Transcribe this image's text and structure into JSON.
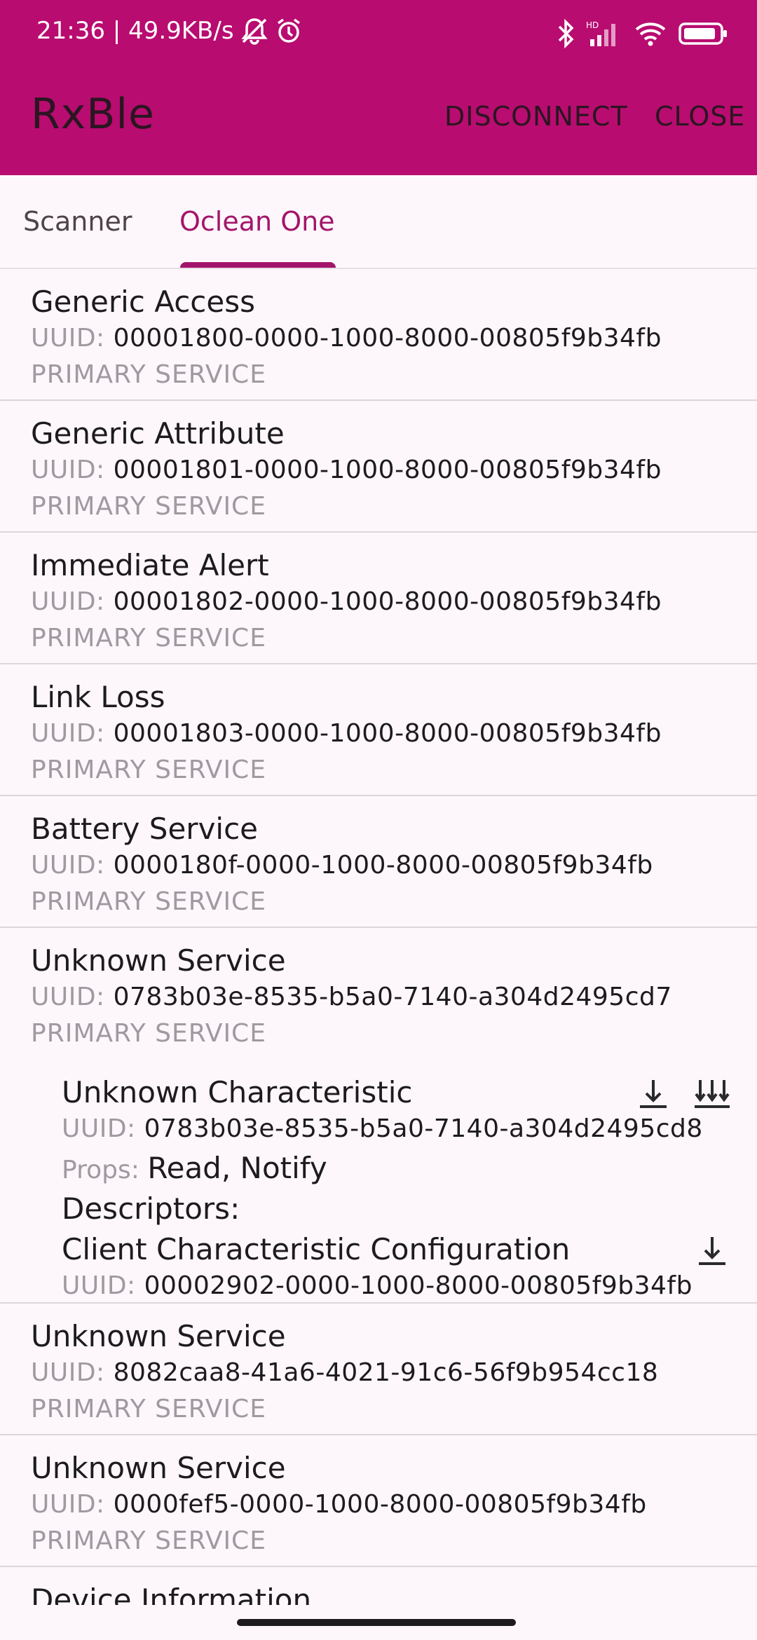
{
  "status": {
    "time_speed": "21:36 | 49.9KB/s",
    "icons": [
      "mute-bell-icon",
      "alarm-icon",
      "bluetooth-icon",
      "signal-hd-icon",
      "wifi-icon",
      "battery-icon"
    ]
  },
  "appbar": {
    "title": "RxBle",
    "disconnect": "DISCONNECT",
    "close": "CLOSE"
  },
  "tabs": [
    {
      "label": "Scanner",
      "active": false
    },
    {
      "label": "Oclean One",
      "active": true
    }
  ],
  "uuid_label": "UUID:",
  "props_label": "Props:",
  "services": [
    {
      "name": "Generic Access",
      "uuid": "00001800-0000-1000-8000-00805f9b34fb",
      "type": "PRIMARY SERVICE"
    },
    {
      "name": "Generic Attribute",
      "uuid": "00001801-0000-1000-8000-00805f9b34fb",
      "type": "PRIMARY SERVICE"
    },
    {
      "name": "Immediate Alert",
      "uuid": "00001802-0000-1000-8000-00805f9b34fb",
      "type": "PRIMARY SERVICE"
    },
    {
      "name": "Link Loss",
      "uuid": "00001803-0000-1000-8000-00805f9b34fb",
      "type": "PRIMARY SERVICE"
    },
    {
      "name": "Battery Service",
      "uuid": "0000180f-0000-1000-8000-00805f9b34fb",
      "type": "PRIMARY SERVICE"
    },
    {
      "name": "Unknown Service",
      "uuid": "0783b03e-8535-b5a0-7140-a304d2495cd7",
      "type": "PRIMARY SERVICE",
      "characteristic": {
        "name": "Unknown Characteristic",
        "uuid": "0783b03e-8535-b5a0-7140-a304d2495cd8",
        "props": "Read, Notify",
        "descriptors_label": "Descriptors:",
        "descriptor": {
          "name": "Client Characteristic Configuration",
          "uuid": "00002902-0000-1000-8000-00805f9b34fb"
        }
      }
    },
    {
      "name": "Unknown Service",
      "uuid": "8082caa8-41a6-4021-91c6-56f9b954cc18",
      "type": "PRIMARY SERVICE"
    },
    {
      "name": "Unknown Service",
      "uuid": "0000fef5-0000-1000-8000-00805f9b34fb",
      "type": "PRIMARY SERVICE"
    },
    {
      "name": "Device Information"
    }
  ],
  "colors": {
    "primary": "#B80C70",
    "accent": "#A3156A",
    "background": "#FDF7FC"
  }
}
